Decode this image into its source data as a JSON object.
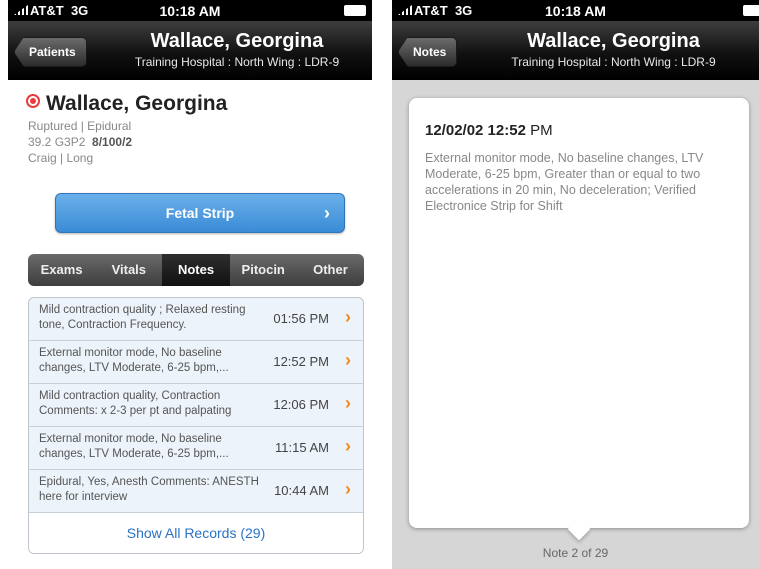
{
  "status": {
    "carrier": "AT&T",
    "network": "3G",
    "time": "10:18 AM"
  },
  "patient": {
    "name": "Wallace, Georgina",
    "location": "Training Hospital : North Wing : LDR-9",
    "line1": "Ruptured  |  Epidural",
    "line2a": "39.2   G3P2",
    "line2b": "8/100/2",
    "line3": "Craig  |  Long"
  },
  "left": {
    "back_label": "Patients",
    "fetal_label": "Fetal Strip",
    "tabs": [
      "Exams",
      "Vitals",
      "Notes",
      "Pitocin",
      "Other"
    ],
    "rows": [
      {
        "text": "Mild contraction quality ; Relaxed resting tone, Contraction Frequency.",
        "time": "01:56 PM"
      },
      {
        "text": "External monitor mode, No baseline changes, LTV Moderate, 6-25 bpm,...",
        "time": "12:52 PM"
      },
      {
        "text": "Mild contraction quality, Contraction Comments: x 2-3 per pt and palpating",
        "time": "12:06 PM"
      },
      {
        "text": "External monitor mode, No baseline changes, LTV Moderate, 6-25 bpm,...",
        "time": "11:15 AM"
      },
      {
        "text": "Epidural, Yes, Anesth Comments: ANESTH here for interview",
        "time": "10:44 AM"
      }
    ],
    "show_all": "Show All Records (29)"
  },
  "right": {
    "back_label": "Notes",
    "note_date": "12/02/02 12:52",
    "note_ampm": "PM",
    "note_body": "External monitor mode, No baseline changes, LTV Moderate, 6-25 bpm, Greater than or equal to two accelerations in 20 min, No deceleration; Verified Electronice Strip for Shift",
    "note_count": "Note 2 of 29"
  },
  "colors": {
    "accent_blue": "#3a8bd6",
    "chevron_orange": "#f08a1c",
    "status_red": "#e83c3c"
  }
}
